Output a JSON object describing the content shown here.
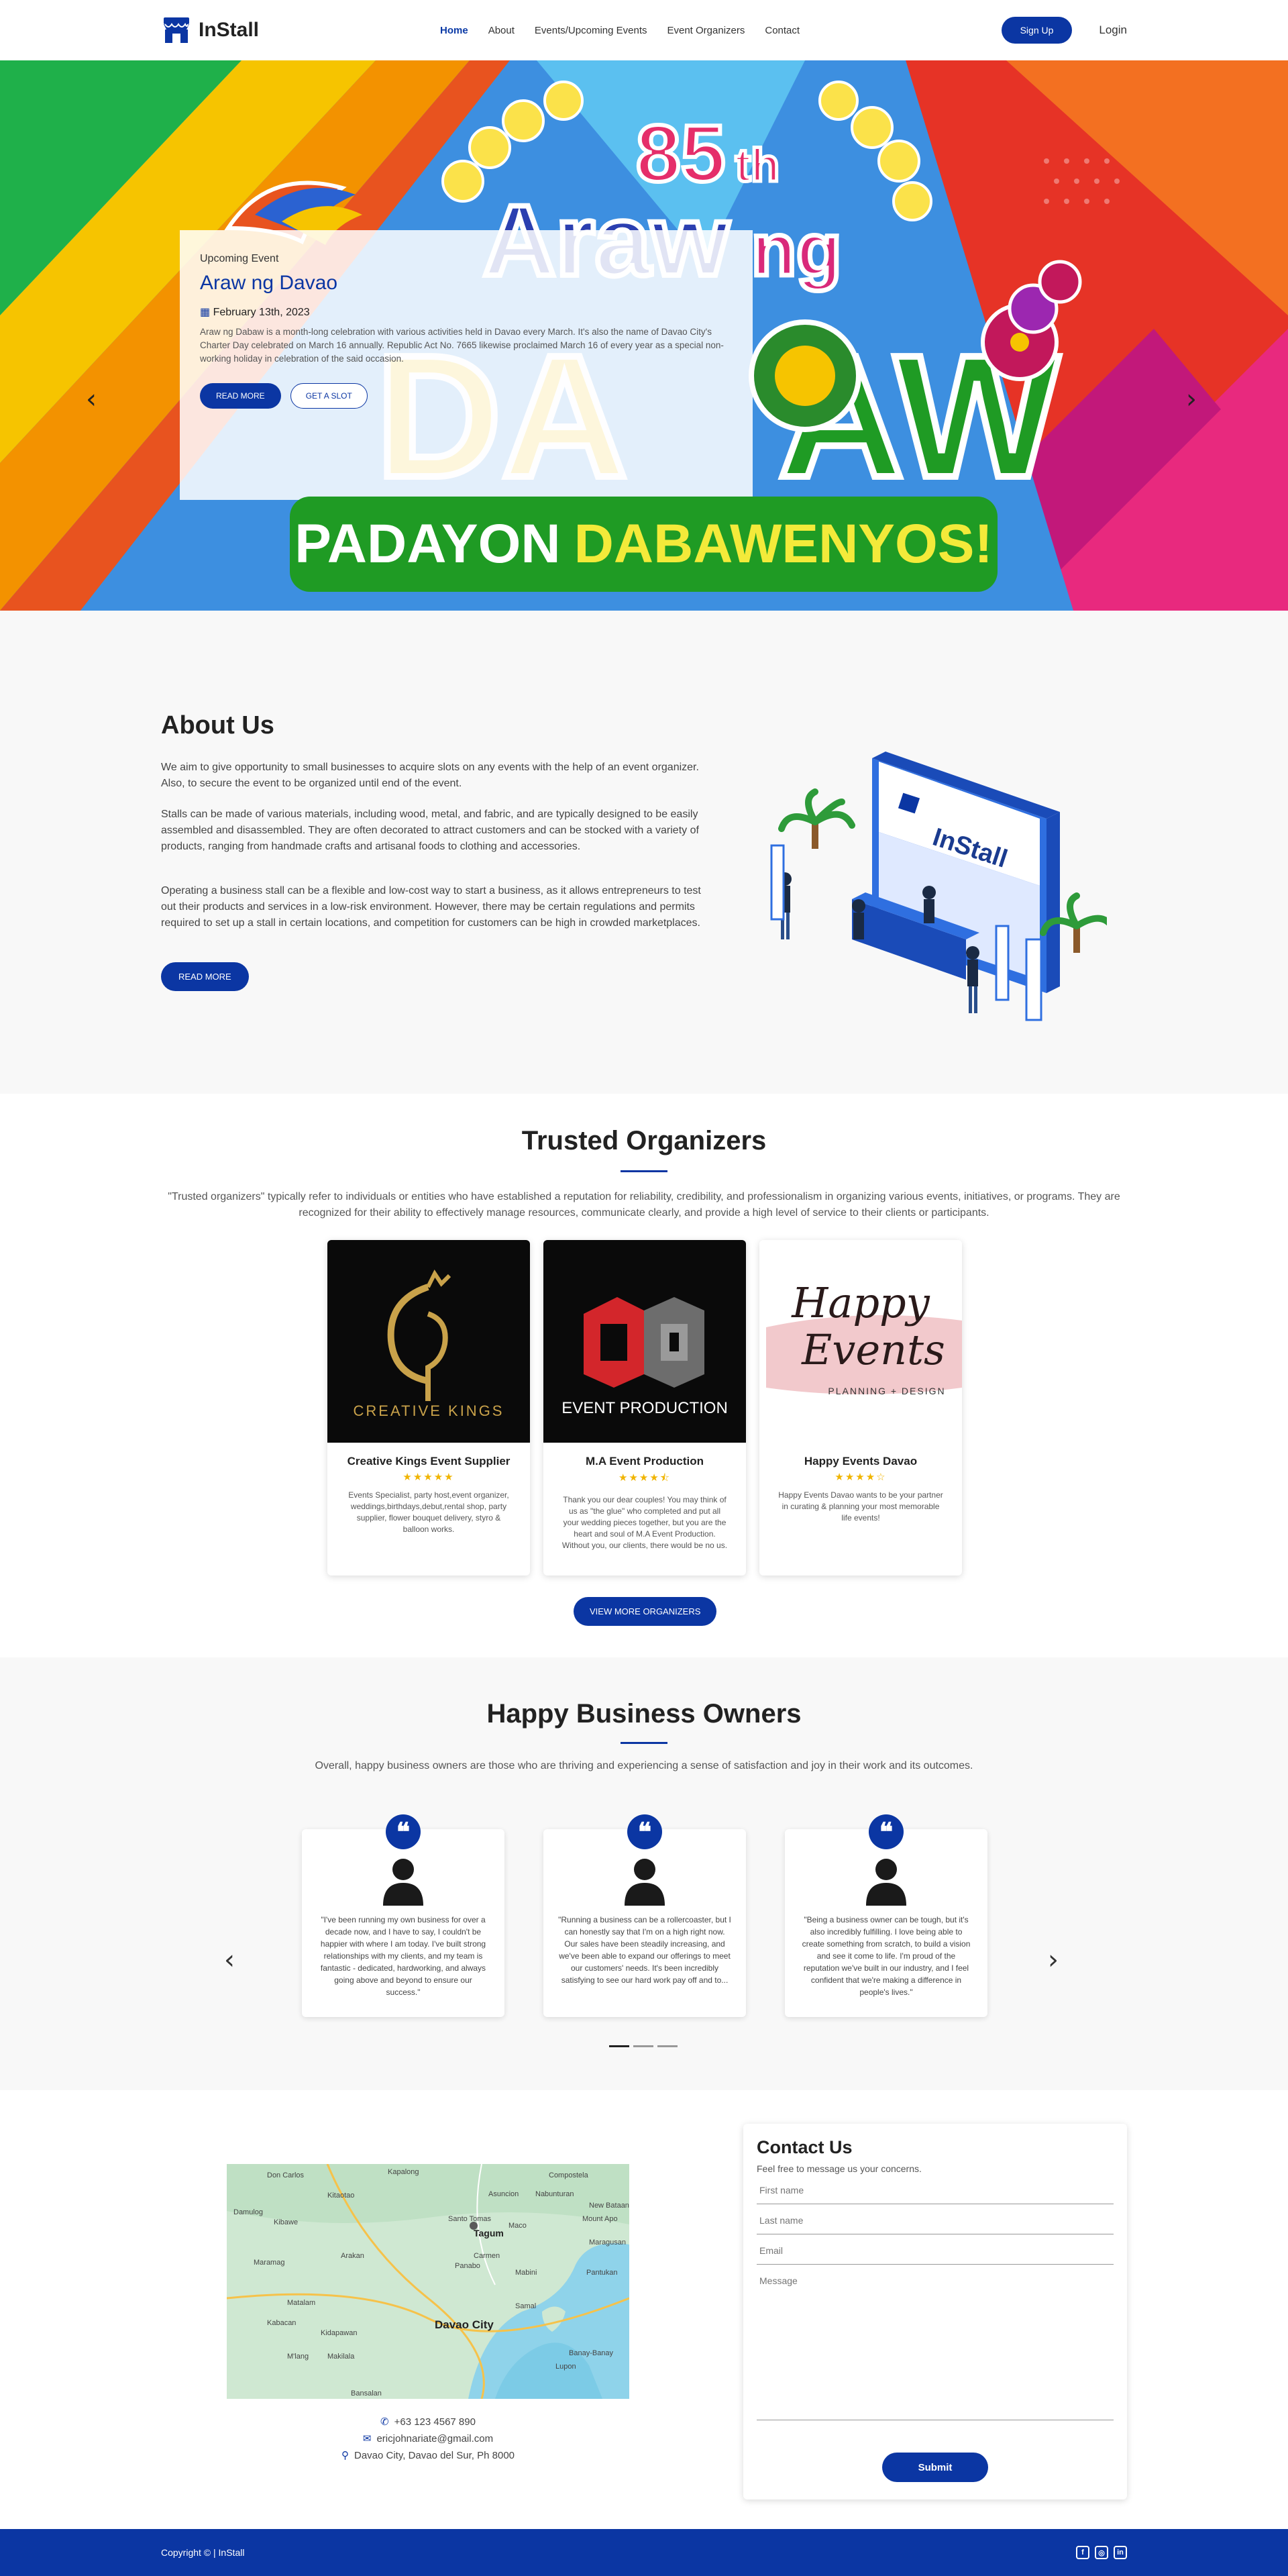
{
  "brand": {
    "name": "InStall",
    "accent": "#0b36a3"
  },
  "nav": {
    "links": [
      "Home",
      "About",
      "Events/Upcoming Events",
      "Event Organizers",
      "Contact"
    ],
    "signup": "Sign Up",
    "login": "Login"
  },
  "hero": {
    "kicker": "Upcoming Event",
    "title": "Araw ng Davao",
    "date": "February 13th, 2023",
    "text": "Araw ng Dabaw is a month-long celebration with various activities held in Davao every March. It's also the name of Davao City's Charter Day celebrated on March 16 annually. Republic Act No. 7665 likewise proclaimed March 16 of every year as a special non-working holiday in celebration of the said occasion.",
    "read_more": "READ MORE",
    "get_slot": "GET A SLOT",
    "banner_top": "85th",
    "banner_mid": "Araw ng",
    "banner_word": "DABAW",
    "padayon_1": "PADAYON",
    "padayon_2": "DABAWENYOS!",
    "prev_icon": "chevron-left-icon",
    "next_icon": "chevron-right-icon"
  },
  "about": {
    "title": "About Us",
    "paragraphs": [
      "We aim to give opportunity to small businesses to acquire slots on any events with the help of an event organizer. Also, to secure the event to be organized until end of the event.",
      "Stalls can be made of various materials, including wood, metal, and fabric, and are typically designed to be easily assembled and disassembled. They are often decorated to attract customers and can be stocked with a variety of products, ranging from handmade crafts and artisanal foods to clothing and accessories.",
      "Operating a business stall can be a flexible and low-cost way to start a business, as it allows entrepreneurs to test out their products and services in a low-risk environment. However, there may be certain regulations and permits required to set up a stall in certain locations, and competition for customers can be high in crowded marketplaces."
    ],
    "button": "READ MORE",
    "booth_label": "InStall"
  },
  "organizers": {
    "title": "Trusted Organizers",
    "description": "\"Trusted organizers\" typically refer to individuals or entities who have established a reputation for reliability, credibility, and professionalism in organizing various events, initiatives, or programs. They are recognized for their ability to effectively manage resources, communicate clearly, and provide a high level of service to their clients or participants.",
    "cards": [
      {
        "name": "Creative Kings Event Supplier",
        "stars": "★★★★★",
        "desc": "Events Specialist, party host,event organizer, weddings,birthdays,debut,rental shop, party supplier, flower bouquet delivery, styro & balloon works.",
        "logo_text": "CREATIVE KINGS"
      },
      {
        "name": "M.A Event Production",
        "stars": "★★★★⯪",
        "desc": "Thank you our dear couples! You may think of us as \"the glue\" who completed and put all your wedding pieces together, but you are the heart and soul of M.A Event Production. Without you, our clients, there would be no us.",
        "logo_text": "EVENT PRODUCTION"
      },
      {
        "name": "Happy Events Davao",
        "stars": "★★★★☆",
        "desc": "Happy Events Davao wants to be your partner in curating & planning your most memorable life events!",
        "logo_text_1": "Happy",
        "logo_text_2": "Events",
        "logo_text_3": "PLANNING + DESIGN"
      }
    ],
    "button": "VIEW MORE ORGANIZERS"
  },
  "happy": {
    "title": "Happy Business Owners",
    "description": "Overall, happy business owners are those who are thriving and experiencing a sense of satisfaction and joy in their work and its outcomes.",
    "testimonials": [
      "\"I've been running my own business for over a decade now, and I have to say, I couldn't be happier with where I am today. I've built strong relationships with my clients, and my team is fantastic - dedicated, hardworking, and always going above and beyond to ensure our success.\"",
      "\"Running a business can be a rollercoaster, but I can honestly say that I'm on a high right now. Our sales have been steadily increasing, and we've been able to expand our offerings to meet our customers' needs. It's been incredibly satisfying to see our hard work pay off and to...",
      "\"Being a business owner can be tough, but it's also incredibly fulfilling. I love being able to create something from scratch, to build a vision and see it come to life. I'm proud of the reputation we've built in our industry, and I feel confident that we're making a difference in people's lives.\""
    ]
  },
  "contact": {
    "phone": "+63 123 4567 890",
    "email": "ericjohnariate@gmail.com",
    "address": "Davao City, Davao del Sur, Ph 8000",
    "map_labels": [
      "Don Carlos",
      "Kitaotao",
      "Kapalong",
      "Asuncion",
      "Nabunturan",
      "Compostela",
      "New Bataan",
      "Santo Tomas",
      "Mount Apo",
      "Maco",
      "Tagum",
      "Carmen",
      "Panabo",
      "Mabini",
      "Pantukan",
      "Maragusan",
      "Davao City",
      "Samal",
      "Banay-Banay",
      "Lupon",
      "Bansalan",
      "Kibawe",
      "Damulog",
      "Arakan",
      "Maramag",
      "Matalam",
      "Kabacan",
      "M'lang",
      "Makilala",
      "Kidapawan"
    ],
    "title": "Contact Us",
    "subtitle": "Feel free to message us your concerns.",
    "fields": {
      "first": "First name",
      "last": "Last name",
      "email": "Email",
      "message": "Message"
    },
    "submit": "Submit"
  },
  "footer": {
    "copyright": "Copyright © | InStall",
    "socials": [
      "f",
      "◎",
      "in"
    ]
  }
}
